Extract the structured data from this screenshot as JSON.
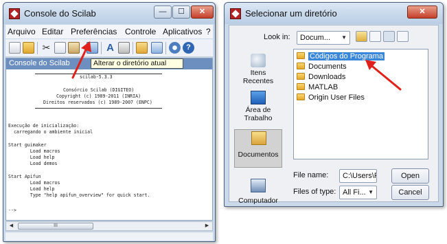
{
  "colors": {
    "title_gradient_top": "#dbe7f4",
    "close_red": "#c4402a",
    "selection_blue": "#3a86d8",
    "annotation_red": "#e0201a",
    "console_header": "#6d8fc0"
  },
  "scilab": {
    "title": "Console do Scilab",
    "window_controls": {
      "minimize": "—",
      "maximize": "☐",
      "close": "✕"
    },
    "menu": [
      "Arquivo",
      "Editar",
      "Preferências",
      "Controle",
      "Aplicativos",
      "?"
    ],
    "toolbar_icons": [
      "new-script-icon",
      "open-file-icon",
      "cut-icon",
      "copy-icon",
      "paste-icon",
      "change-directory-icon",
      "font-icon",
      "print-icon",
      "variable-browser-icon",
      "history-icon",
      "module-manager-icon",
      "help-icon"
    ],
    "console_title": "Console do Scilab",
    "tooltip": "Alterar o diretório atual",
    "console_lines": {
      "version": "scilab-5.3.3",
      "consortium": "Consórcio Scilab (DIGITEO)",
      "copyright1": "Copyright (c) 1989-2011 (INRIA)",
      "copyright2": "Direitos reservados (c) 1989-2007 (ENPC)",
      "exec_start": "Execução de inicialização:",
      "loading_env": "  carregando o ambiente inicial",
      "start_guimaker": "Start guimaker",
      "load_macros": "        Load macros",
      "load_help": "        Load help",
      "load_demos": "        Load demos",
      "start_apifun": "Start Apifun",
      "load_macros2": "        Load macros",
      "load_help2": "        Load help",
      "type_help": "        Type \"help apifun_overview\" for quick start.",
      "prompt": "-->"
    },
    "scroll_left": "◀",
    "scroll_right": "▶",
    "scroll_thumb": "III"
  },
  "dialog": {
    "title": "Selecionar um diretório",
    "close": "✕",
    "look_in_label": "Look in:",
    "look_in_value": "Docum...",
    "places": [
      {
        "label": "Itens Recentes",
        "icon": "recent-items-icon"
      },
      {
        "label": "Área de Trabalho",
        "icon": "desktop-icon"
      },
      {
        "label": "Documentos",
        "icon": "documents-icon"
      },
      {
        "label": "Computador",
        "icon": "computer-icon"
      }
    ],
    "files": [
      "Códigos do Programa",
      "Documents",
      "Downloads",
      "MATLAB",
      "Origin User Files"
    ],
    "selected_file": "Códigos do Programa",
    "file_name_label": "File name:",
    "file_name_value": "C:\\Users\\F\\",
    "files_of_type_label": "Files of type:",
    "files_of_type_value": "All Fi...",
    "open_button": "Open",
    "cancel_button": "Cancel"
  }
}
